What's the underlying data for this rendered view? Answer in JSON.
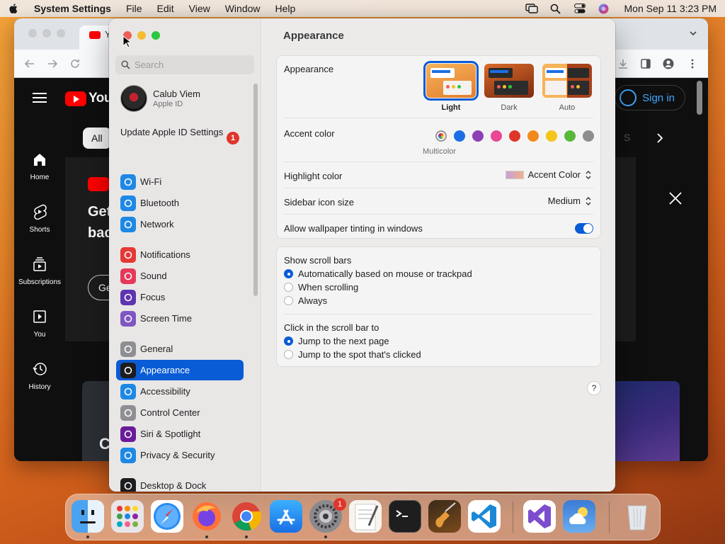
{
  "menubar": {
    "app_name": "System Settings",
    "menus": [
      "File",
      "Edit",
      "View",
      "Window",
      "Help"
    ],
    "clock": "Mon Sep 11  3:23 PM"
  },
  "browser": {
    "tab_title": "Y",
    "logo_text": "YouT",
    "sign_in": "Sign in",
    "chip": "All",
    "chip_right": "S",
    "hero_text_1": "Get",
    "hero_text_2": "bac",
    "hero_button": "Ge",
    "thumb_text": "C",
    "sidebar": [
      {
        "label": "Home"
      },
      {
        "label": "Shorts"
      },
      {
        "label": "Subscriptions"
      },
      {
        "label": "You"
      },
      {
        "label": "History"
      }
    ]
  },
  "settings": {
    "search_placeholder": "Search",
    "profile": {
      "name": "Calub Viem",
      "subtitle": "Apple ID"
    },
    "update_text": "Update Apple ID Settings",
    "update_badge": "1",
    "nav": [
      {
        "label": "Wi-Fi",
        "color": "#1e88e5",
        "icon": "wifi-icon"
      },
      {
        "label": "Bluetooth",
        "color": "#1e88e5",
        "icon": "bluetooth-icon"
      },
      {
        "label": "Network",
        "color": "#1e88e5",
        "icon": "globe-icon"
      },
      {
        "label": "Notifications",
        "color": "#e53935",
        "icon": "bell-icon"
      },
      {
        "label": "Sound",
        "color": "#e53959",
        "icon": "speaker-icon"
      },
      {
        "label": "Focus",
        "color": "#5e35b1",
        "icon": "moon-icon"
      },
      {
        "label": "Screen Time",
        "color": "#7e57c2",
        "icon": "hourglass-icon"
      },
      {
        "label": "General",
        "color": "#8e8e93",
        "icon": "gear-icon"
      },
      {
        "label": "Appearance",
        "color": "#1d1d1f",
        "icon": "appearance-icon",
        "selected": true
      },
      {
        "label": "Accessibility",
        "color": "#1e88e5",
        "icon": "accessibility-icon"
      },
      {
        "label": "Control Center",
        "color": "#8e8e93",
        "icon": "control-center-icon"
      },
      {
        "label": "Siri & Spotlight",
        "color": "#6a1b9a",
        "icon": "siri-icon"
      },
      {
        "label": "Privacy & Security",
        "color": "#1e88e5",
        "icon": "hand-icon"
      },
      {
        "label": "Desktop & Dock",
        "color": "#1d1d1f",
        "icon": "dock-icon"
      }
    ],
    "title": "Appearance",
    "appearance_label": "Appearance",
    "themes": [
      {
        "name": "Light",
        "selected": true
      },
      {
        "name": "Dark",
        "selected": false
      },
      {
        "name": "Auto",
        "selected": false
      }
    ],
    "accent_label": "Accent color",
    "accent_colors": [
      "multicolor",
      "#1b6fe4",
      "#8e3fb8",
      "#e84896",
      "#e0352b",
      "#f08a1d",
      "#f5c518",
      "#58b83a",
      "#8e8e8e"
    ],
    "accent_selected_name": "Multicolor",
    "highlight_label": "Highlight color",
    "highlight_value": "Accent Color",
    "icon_size_label": "Sidebar icon size",
    "icon_size_value": "Medium",
    "tinting_label": "Allow wallpaper tinting in windows",
    "tinting_on": true,
    "scroll_bars_label": "Show scroll bars",
    "scroll_bar_options": [
      {
        "label": "Automatically based on mouse or trackpad",
        "selected": true
      },
      {
        "label": "When scrolling",
        "selected": false
      },
      {
        "label": "Always",
        "selected": false
      }
    ],
    "click_label": "Click in the scroll bar to",
    "click_options": [
      {
        "label": "Jump to the next page",
        "selected": true
      },
      {
        "label": "Jump to the spot that's clicked",
        "selected": false
      }
    ],
    "help": "?"
  },
  "dock": {
    "settings_badge": "1"
  }
}
